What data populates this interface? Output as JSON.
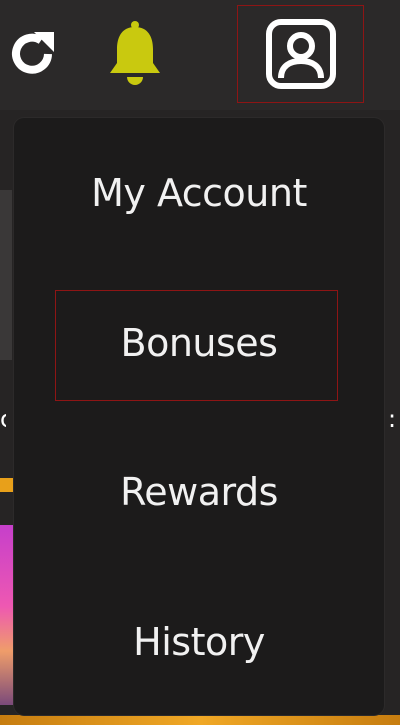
{
  "toolbar": {
    "refresh_icon": "refresh-icon",
    "bell_icon": "bell-icon",
    "profile_icon": "user-profile-icon",
    "colors": {
      "icon_white": "#ffffff",
      "bell_yellow": "#c9c90f",
      "highlight_border": "#8e1515"
    }
  },
  "account_menu": {
    "items": [
      {
        "label": "My Account"
      },
      {
        "label": "Bonuses"
      },
      {
        "label": "Rewards"
      },
      {
        "label": "History"
      }
    ],
    "highlighted_item": "Bonuses",
    "background": "#1c1b1b"
  }
}
